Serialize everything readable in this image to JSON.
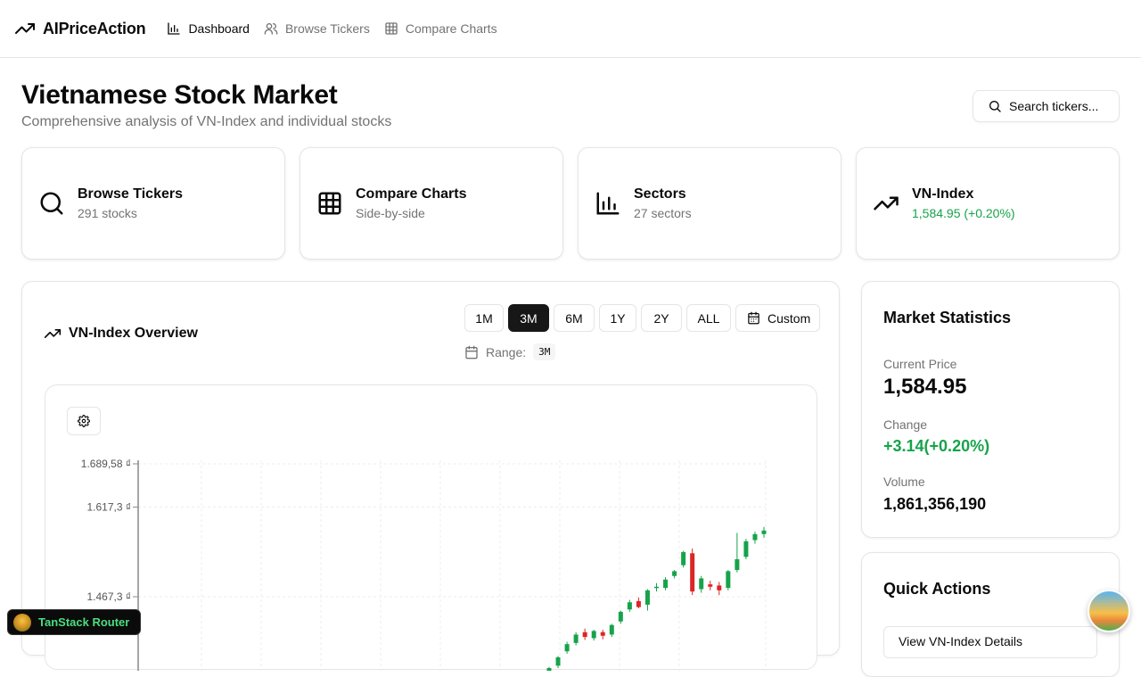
{
  "nav": {
    "brand": "AIPriceAction",
    "links": [
      {
        "label": "Dashboard",
        "icon": "bar-chart-icon",
        "active": true
      },
      {
        "label": "Browse Tickers",
        "icon": "users-icon",
        "active": false
      },
      {
        "label": "Compare Charts",
        "icon": "grid-icon",
        "active": false
      }
    ]
  },
  "header": {
    "title": "Vietnamese Stock Market",
    "subtitle": "Comprehensive analysis of VN-Index and individual stocks",
    "search_label": "Search tickers..."
  },
  "cards": [
    {
      "title": "Browse Tickers",
      "sub": "291 stocks",
      "icon": "search-icon"
    },
    {
      "title": "Compare Charts",
      "sub": "Side-by-side",
      "icon": "grid-icon"
    },
    {
      "title": "Sectors",
      "sub": "27 sectors",
      "icon": "bar-chart-icon"
    },
    {
      "title": "VN-Index",
      "sub": "1,584.95 (+0.20%)",
      "icon": "trending-up-icon",
      "sub_color": "#16a34a"
    }
  ],
  "overview": {
    "title": "VN-Index Overview",
    "ranges": [
      "1M",
      "3M",
      "6M",
      "1Y",
      "2Y",
      "ALL"
    ],
    "active_range": "3M",
    "custom_label": "Custom",
    "range_label": "Range:",
    "range_value": "3M"
  },
  "stats": {
    "title": "Market Statistics",
    "current_price_label": "Current Price",
    "current_price": "1,584.95",
    "change_label": "Change",
    "change": "+3.14(+0.20%)",
    "volume_label": "Volume",
    "volume": "1,861,356,190"
  },
  "actions": {
    "title": "Quick Actions",
    "first_action": "View VN-Index Details"
  },
  "devtools": {
    "label": "TanStack Router"
  },
  "colors": {
    "up": "#16a34a",
    "down": "#dc2626",
    "accent": "#171717"
  },
  "chart_data": {
    "type": "candlestick",
    "currency_suffix": "₫",
    "y_ticks": [
      "1.689,58 ₫",
      "1.617,3 ₫",
      "1.467,3 ₫"
    ],
    "y_tick_values": [
      1689.58,
      1617.3,
      1467.3
    ],
    "candles": [
      {
        "o": 1338,
        "h": 1350,
        "l": 1332,
        "c": 1348
      },
      {
        "o": 1352,
        "h": 1368,
        "l": 1348,
        "c": 1366
      },
      {
        "o": 1376,
        "h": 1392,
        "l": 1372,
        "c": 1388
      },
      {
        "o": 1390,
        "h": 1408,
        "l": 1386,
        "c": 1404
      },
      {
        "o": 1408,
        "h": 1414,
        "l": 1395,
        "c": 1400
      },
      {
        "o": 1398,
        "h": 1412,
        "l": 1394,
        "c": 1410
      },
      {
        "o": 1408,
        "h": 1412,
        "l": 1396,
        "c": 1402
      },
      {
        "o": 1404,
        "h": 1422,
        "l": 1400,
        "c": 1420
      },
      {
        "o": 1426,
        "h": 1444,
        "l": 1422,
        "c": 1442
      },
      {
        "o": 1446,
        "h": 1462,
        "l": 1442,
        "c": 1458
      },
      {
        "o": 1460,
        "h": 1466,
        "l": 1448,
        "c": 1450
      },
      {
        "o": 1454,
        "h": 1480,
        "l": 1444,
        "c": 1478
      },
      {
        "o": 1482,
        "h": 1490,
        "l": 1476,
        "c": 1484
      },
      {
        "o": 1482,
        "h": 1500,
        "l": 1478,
        "c": 1496
      },
      {
        "o": 1502,
        "h": 1512,
        "l": 1498,
        "c": 1510
      },
      {
        "o": 1520,
        "h": 1544,
        "l": 1516,
        "c": 1542
      },
      {
        "o": 1540,
        "h": 1548,
        "l": 1470,
        "c": 1476
      },
      {
        "o": 1480,
        "h": 1502,
        "l": 1474,
        "c": 1498
      },
      {
        "o": 1488,
        "h": 1494,
        "l": 1478,
        "c": 1484
      },
      {
        "o": 1486,
        "h": 1492,
        "l": 1470,
        "c": 1478
      },
      {
        "o": 1482,
        "h": 1512,
        "l": 1478,
        "c": 1510
      },
      {
        "o": 1512,
        "h": 1574,
        "l": 1508,
        "c": 1530
      },
      {
        "o": 1534,
        "h": 1564,
        "l": 1530,
        "c": 1560
      },
      {
        "o": 1562,
        "h": 1576,
        "l": 1556,
        "c": 1572
      },
      {
        "o": 1572,
        "h": 1584,
        "l": 1566,
        "c": 1578
      }
    ],
    "grid": true
  }
}
